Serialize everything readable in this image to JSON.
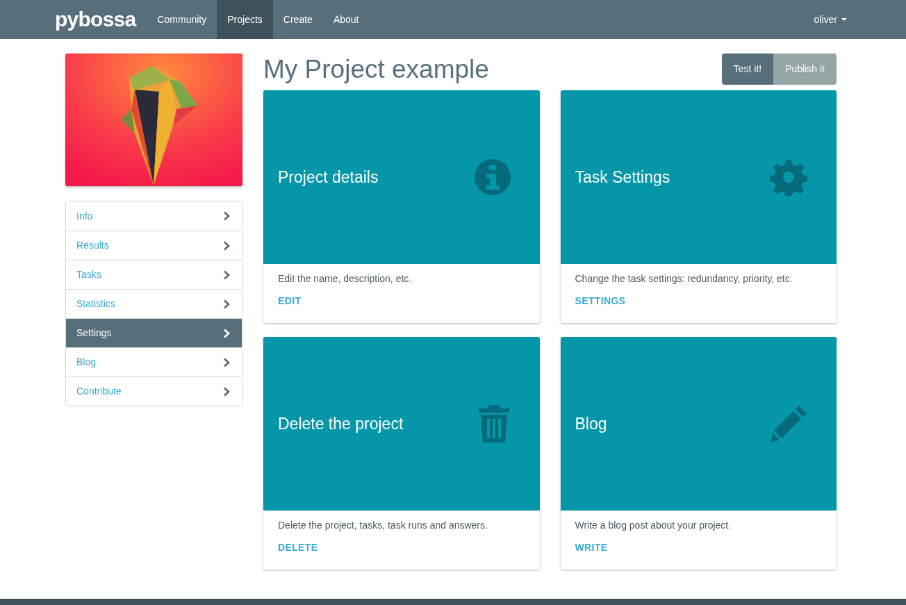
{
  "navbar": {
    "brand": "pybossa",
    "items": [
      {
        "label": "Community",
        "selected": false
      },
      {
        "label": "Projects",
        "selected": true
      },
      {
        "label": "Create",
        "selected": false
      },
      {
        "label": "About",
        "selected": false
      }
    ],
    "user": "oliver"
  },
  "sidebar": {
    "items": [
      {
        "label": "Info",
        "selected": false
      },
      {
        "label": "Results",
        "selected": false
      },
      {
        "label": "Tasks",
        "selected": false
      },
      {
        "label": "Statistics",
        "selected": false
      },
      {
        "label": "Settings",
        "selected": true
      },
      {
        "label": "Blog",
        "selected": false
      },
      {
        "label": "Contribute",
        "selected": false
      }
    ]
  },
  "page": {
    "title": "My Project example",
    "buttons": [
      {
        "label": "Test it!",
        "kind": "primary"
      },
      {
        "label": "Publish it",
        "kind": "secondary"
      }
    ]
  },
  "cards": [
    {
      "title": "Project details",
      "kind": "info",
      "description": "Edit the name, description, etc.",
      "action": "EDIT"
    },
    {
      "title": "Task Settings",
      "kind": "gear",
      "description": "Change the task settings: redundancy, priority, etc.",
      "action": "SETTINGS"
    },
    {
      "title": "Delete the project",
      "kind": "trash",
      "description": "Delete the project, tasks, task runs and answers.",
      "action": "DELETE"
    },
    {
      "title": "Blog",
      "kind": "pencil",
      "description": "Write a blog post about your project.",
      "action": "WRITE"
    }
  ]
}
